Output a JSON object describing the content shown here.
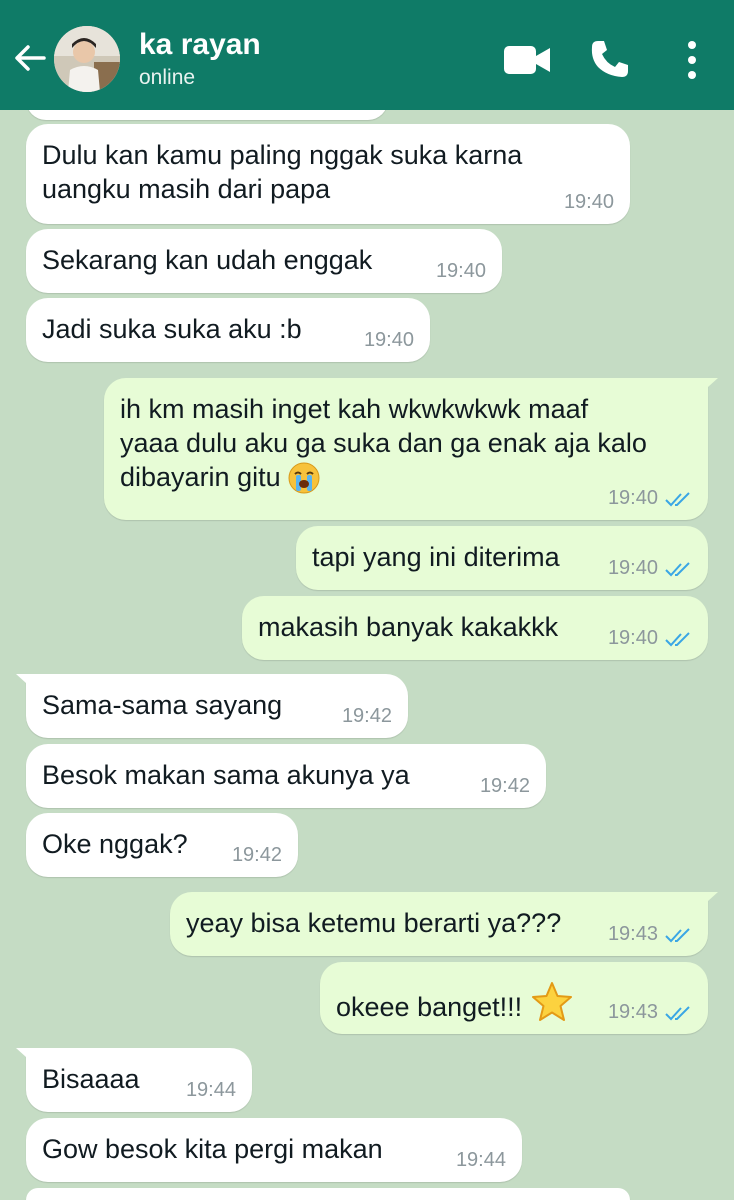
{
  "header": {
    "contact_name": "ka rayan",
    "status": "online",
    "icons": [
      "back-arrow-icon",
      "video-call-icon",
      "voice-call-icon",
      "more-options-icon"
    ],
    "colors": {
      "header_bg": "#0f7b67",
      "chat_bg": "#c5dcc4",
      "incoming_bg": "#ffffff",
      "outgoing_bg": "#e7fcd6",
      "read_tick": "#3aa6e5"
    }
  },
  "messages": [
    {
      "dir": "in",
      "text": "Dulu kan kamu paling nggak suka karna\nuangku masih dari papa",
      "time": "19:40"
    },
    {
      "dir": "in",
      "text": "Sekarang kan udah enggak",
      "time": "19:40"
    },
    {
      "dir": "in",
      "text": "Jadi suka suka aku :b",
      "time": "19:40"
    },
    {
      "dir": "out",
      "text": "ih km masih inget kah wkwkwkwk maaf\nyaaa dulu aku ga suka dan ga enak aja kalo\ndibayarin gitu",
      "emoji": "crying-face-emoji",
      "time": "19:40",
      "status": "read"
    },
    {
      "dir": "out",
      "text": "tapi yang ini diterima",
      "time": "19:40",
      "status": "read"
    },
    {
      "dir": "out",
      "text": "makasih banyak kakakkk",
      "time": "19:40",
      "status": "read"
    },
    {
      "dir": "in",
      "text": "Sama-sama sayang",
      "time": "19:42"
    },
    {
      "dir": "in",
      "text": "Besok makan sama akunya ya",
      "time": "19:42"
    },
    {
      "dir": "in",
      "text": "Oke nggak?",
      "time": "19:42"
    },
    {
      "dir": "out",
      "text": "yeay bisa ketemu berarti ya???",
      "time": "19:43",
      "status": "read"
    },
    {
      "dir": "out",
      "text": "okeee banget!!!",
      "emoji": "star-emoji",
      "time": "19:43",
      "status": "read"
    },
    {
      "dir": "in",
      "text": "Bisaaaa",
      "time": "19:44"
    },
    {
      "dir": "in",
      "text": "Gow besok kita pergi makan",
      "time": "19:44"
    }
  ]
}
